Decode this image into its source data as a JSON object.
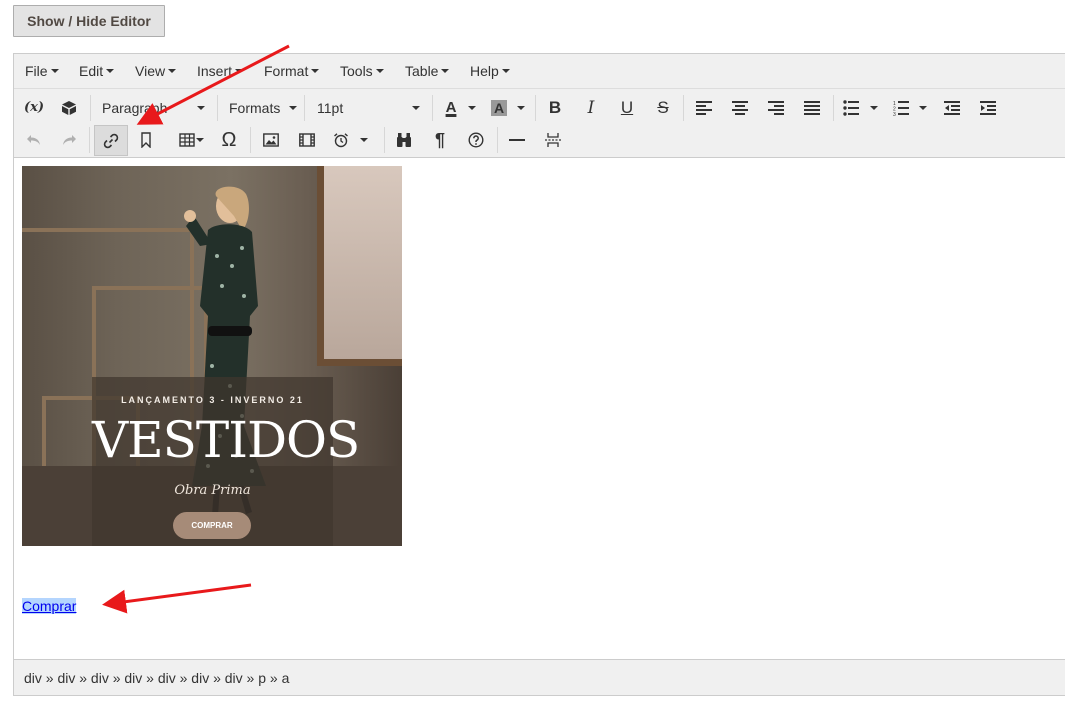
{
  "toggle_button": "Show / Hide Editor",
  "menu": [
    "File",
    "Edit",
    "View",
    "Insert",
    "Format",
    "Tools",
    "Table",
    "Help"
  ],
  "toolbar": {
    "variable_label": "(x)",
    "block_select": "Paragraph",
    "formats_select": "Formats",
    "font_size": "11pt",
    "bold": "B",
    "italic": "I",
    "underline": "U",
    "strike": "S",
    "font_color_letter": "A",
    "bg_color_letter": "A",
    "omega": "Ω",
    "pilcrow": "¶"
  },
  "image": {
    "subtitle": "LANÇAMENTO 3 - INVERNO 21",
    "title": "VESTIDOS",
    "script": "Obra Prima",
    "button": "COMPRAR"
  },
  "link_text": "Comprar",
  "statusbar_path": "div » div » div » div » div » div » div » p » a",
  "colors": {
    "arrow": "#e8191b",
    "link": "#0000ee",
    "selection": "#b4d5fe"
  }
}
